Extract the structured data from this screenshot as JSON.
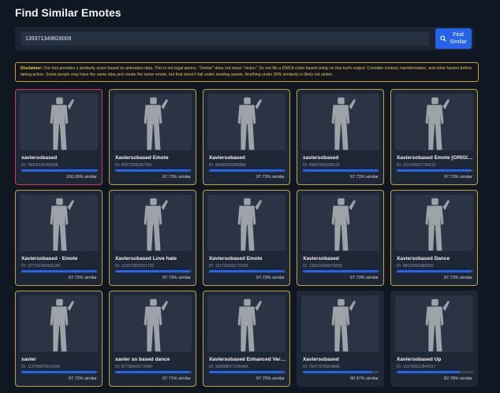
{
  "page_title": "Find Similar Emotes",
  "search": {
    "value": "139371349828009",
    "placeholder": ""
  },
  "find_button": {
    "label": "Find Similar"
  },
  "disclaimer": {
    "heading": "Disclaimer:",
    "text": " Our tool provides a similarity score based on animation data. This is not legal advice. \"Similar\" does not mean \"stolen.\" Do not file a DMCA claim based solely on this tool's output. Consider context, transformation, and other factors before taking action. Some people may have the same idea and create the same emote, but that doesn't fall under stealing assets. Anything under 90% similarity is likely not stolen."
  },
  "colors": {
    "accent": "#2563eb",
    "highlight_border": "#caa233",
    "top_border": "#dc3545",
    "background": "#0f1722"
  },
  "results": [
    {
      "name": "xaviersobased",
      "id": "ID: 78422134782608",
      "similarity": 100.0,
      "similarity_label": "100.00% similar",
      "style": "top"
    },
    {
      "name": "Xaviersobased Emote",
      "id": "ID: 83972330097955",
      "similarity": 97.73,
      "similarity_label": "97.73% similar",
      "style": "gold"
    },
    {
      "name": "Xaviersobased",
      "id": "ID: 96682260285884",
      "similarity": 97.73,
      "similarity_label": "97.73% similar",
      "style": "gold"
    },
    {
      "name": "xaviersobased",
      "id": "ID: 99687681838132",
      "similarity": 97.73,
      "similarity_label": "97.73% similar",
      "style": "gold"
    },
    {
      "name": "Xaviersobased Emote [ORIGINAL]",
      "id": "ID: 101243637790616",
      "similarity": 97.73,
      "similarity_label": "97.73% similar",
      "style": "gold"
    },
    {
      "name": "Xaviersobased - Emote",
      "id": "ID: 107742309431240",
      "similarity": 97.73,
      "similarity_label": "97.73% similar",
      "style": "gold"
    },
    {
      "name": "Xaviersobased Love hate",
      "id": "ID: 113572810251792",
      "similarity": 97.73,
      "similarity_label": "97.73% similar",
      "style": "gold"
    },
    {
      "name": "Xaviersobased Emote",
      "id": "ID: 131763631172238",
      "similarity": 97.73,
      "similarity_label": "97.73% similar",
      "style": "gold"
    },
    {
      "name": "Xaviersobased",
      "id": "ID: 139922466579439",
      "similarity": 97.73,
      "similarity_label": "97.73% similar",
      "style": "gold"
    },
    {
      "name": "Xaviersobased Dance",
      "id": "ID: 98019599980592",
      "similarity": 97.73,
      "similarity_label": "97.73% similar",
      "style": "gold"
    },
    {
      "name": "xavier",
      "id": "ID: 113795879614345",
      "similarity": 97.72,
      "similarity_label": "97.72% similar",
      "style": "gold"
    },
    {
      "name": "xavier so based dance",
      "id": "ID: 87756443172440",
      "similarity": 97.71,
      "similarity_label": "97.71% similar",
      "style": "gold"
    },
    {
      "name": "Xaviersobased Enhanced Version",
      "id": "ID: 108098077245446",
      "similarity": 97.7,
      "similarity_label": "97.70% similar",
      "style": "gold"
    },
    {
      "name": "Xaviersobased",
      "id": "ID: 78477078204899",
      "similarity": 90.97,
      "similarity_label": "90.97% similar",
      "style": "plain"
    },
    {
      "name": "Xaviersobased Up",
      "id": "ID: 133789612844317",
      "similarity": 82.78,
      "similarity_label": "82.78% similar",
      "style": "plain"
    }
  ]
}
